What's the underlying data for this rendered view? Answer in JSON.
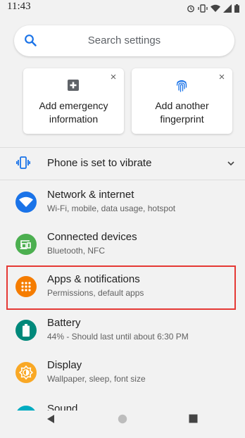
{
  "status_bar": {
    "time": "11:43",
    "icons": [
      "alarm-icon",
      "vibrate-icon",
      "wifi-icon",
      "signal-icon",
      "battery-icon"
    ]
  },
  "search": {
    "placeholder": "Search settings",
    "icon": "search-icon",
    "accent_color": "#1a73e8"
  },
  "suggestions": [
    {
      "label": "Add emergency information",
      "icon": "medical-plus-icon",
      "close": "×"
    },
    {
      "label": "Add another fingerprint",
      "icon": "fingerprint-icon",
      "close": "×"
    }
  ],
  "condition": {
    "label": "Phone is set to vibrate",
    "icon": "vibrate-icon",
    "expand_icon": "chevron-down-icon"
  },
  "items": [
    {
      "title": "Network & internet",
      "subtitle": "Wi-Fi, mobile, data usage, hotspot",
      "icon": "wifi-icon",
      "color": "#1a73e8"
    },
    {
      "title": "Connected devices",
      "subtitle": "Bluetooth, NFC",
      "icon": "devices-icon",
      "color": "#4caf50"
    },
    {
      "title": "Apps & notifications",
      "subtitle": "Permissions, default apps",
      "icon": "apps-icon",
      "color": "#f57c00",
      "highlighted": true
    },
    {
      "title": "Battery",
      "subtitle": "44% - Should last until about 6:30 PM",
      "icon": "battery-icon",
      "color": "#00897b"
    },
    {
      "title": "Display",
      "subtitle": "Wallpaper, sleep, font size",
      "icon": "display-icon",
      "color": "#f9a825"
    },
    {
      "title": "Sound",
      "subtitle": "",
      "icon": "sound-icon",
      "color": "#00acc1"
    }
  ],
  "nav_bar": {
    "buttons": [
      "back-icon",
      "home-icon",
      "recents-icon"
    ]
  },
  "highlight_color": "#e53935"
}
